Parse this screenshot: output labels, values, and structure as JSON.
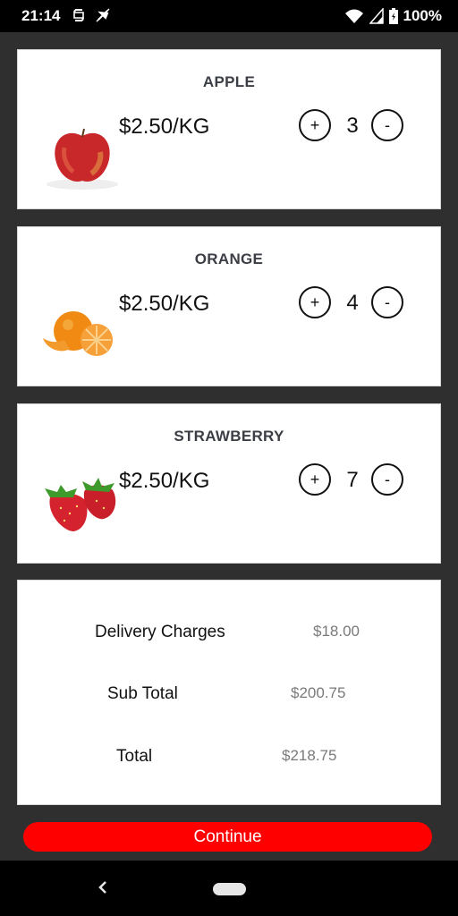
{
  "status_bar": {
    "time": "21:14",
    "battery": "100%",
    "icons": [
      "sync-icon",
      "no-location-icon",
      "wifi-icon",
      "signal-icon",
      "battery-icon"
    ]
  },
  "products": [
    {
      "name": "APPLE",
      "price": "$2.50/KG",
      "quantity": "3",
      "plus": "+",
      "minus": "-",
      "image": "apple"
    },
    {
      "name": "ORANGE",
      "price": "$2.50/KG",
      "quantity": "4",
      "plus": "+",
      "minus": "-",
      "image": "orange"
    },
    {
      "name": "STRAWBERRY",
      "price": "$2.50/KG",
      "quantity": "7",
      "plus": "+",
      "minus": "-",
      "image": "strawberry"
    }
  ],
  "summary": {
    "delivery_label": "Delivery Charges",
    "delivery_value": "$18.00",
    "subtotal_label": "Sub Total",
    "subtotal_value": "$200.75",
    "total_label": "Total",
    "total_value": "$218.75"
  },
  "continue_label": "Continue",
  "colors": {
    "background": "#2f2f2f",
    "accent": "#ff0000",
    "card": "#ffffff"
  }
}
